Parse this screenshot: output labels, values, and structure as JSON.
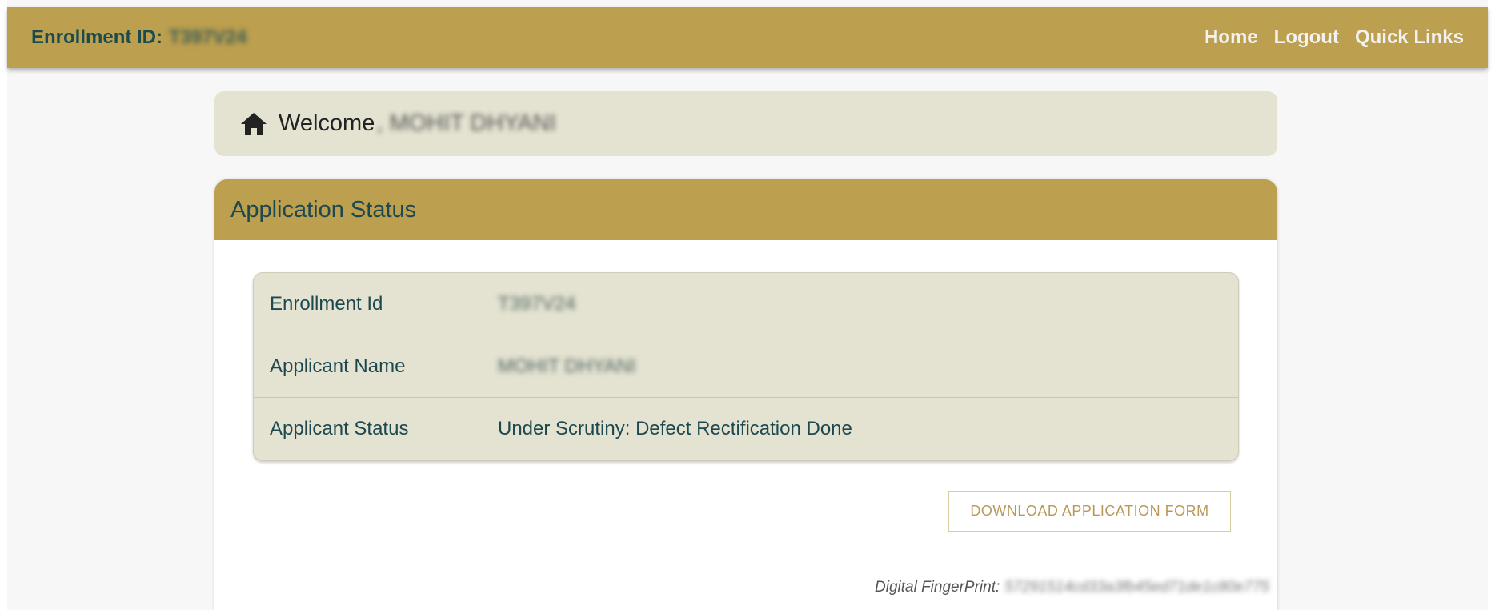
{
  "header": {
    "enrollment_label": "Enrollment ID:",
    "enrollment_value": "T397V24",
    "nav": [
      "Home",
      "Logout",
      "Quick Links"
    ]
  },
  "welcome": {
    "label": "Welcome",
    "name": ", MOHIT DHYANI"
  },
  "card": {
    "title": "Application Status",
    "rows": [
      {
        "label": "Enrollment Id",
        "value": "T397V24"
      },
      {
        "label": "Applicant Name",
        "value": "MOHIT DHYANI"
      },
      {
        "label": "Applicant Status",
        "value": "Under Scrutiny: Defect Rectification Done"
      }
    ],
    "download_button": "DOWNLOAD APPLICATION FORM",
    "fingerprint_label": "Digital FingerPrint:",
    "fingerprint_value": "57291514cd33a3fb45ed71de1c80e775"
  },
  "colors": {
    "brand_gold": "#bc9f4f",
    "panel_beige": "#e4e2d0",
    "text_teal": "#1d4850"
  },
  "icons": {
    "welcome": "home-icon"
  }
}
